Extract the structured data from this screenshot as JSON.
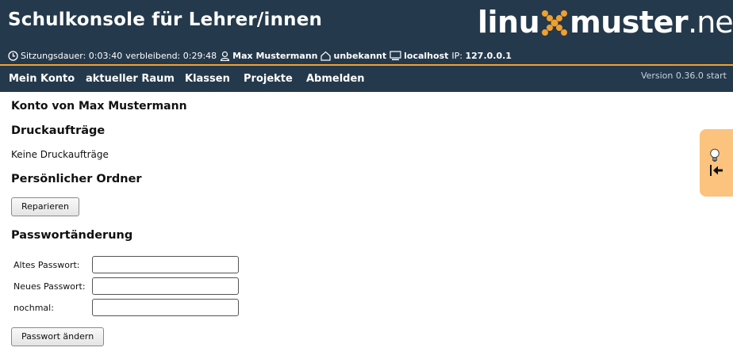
{
  "header": {
    "title": "Schulkonsole für Lehrer/innen",
    "logo": {
      "part1": "linu",
      "part2": "muster",
      "part3": ".net"
    },
    "session": {
      "duration_label": "Sitzungsdauer:",
      "duration_value": "0:03:40",
      "remaining_label": "verbleibend:",
      "remaining_value": "0:29:48",
      "user": "Max Mustermann",
      "room": "unbekannt",
      "host": "localhost",
      "ip_label": "IP:",
      "ip_value": "127.0.0.1"
    }
  },
  "nav": {
    "items": [
      "Mein Konto",
      "aktueller Raum",
      "Klassen",
      "Projekte",
      "Abmelden"
    ],
    "version": "Version 0.36.0 start"
  },
  "main": {
    "account_title": "Konto von Max Mustermann",
    "print_jobs_heading": "Druckaufträge",
    "print_jobs_text": "Keine Druckaufträge",
    "folder_heading": "Persönlicher Ordner",
    "repair_button": "Reparieren",
    "password_heading": "Passwortänderung",
    "password_form": {
      "old_label": "Altes Passwort:",
      "new_label": "Neues Passwort:",
      "repeat_label": "nochmal:",
      "old_value": "",
      "new_value": "",
      "repeat_value": ""
    },
    "change_button": "Passwort ändern"
  },
  "colors": {
    "header_bg": "#24394c",
    "accent": "#f0a030",
    "sidetab_bg": "#fbc37d"
  },
  "icons": [
    "clock-icon",
    "user-icon",
    "home-icon",
    "computer-icon",
    "lightbulb-icon",
    "collapse-left-icon",
    "logo-x-mark"
  ]
}
